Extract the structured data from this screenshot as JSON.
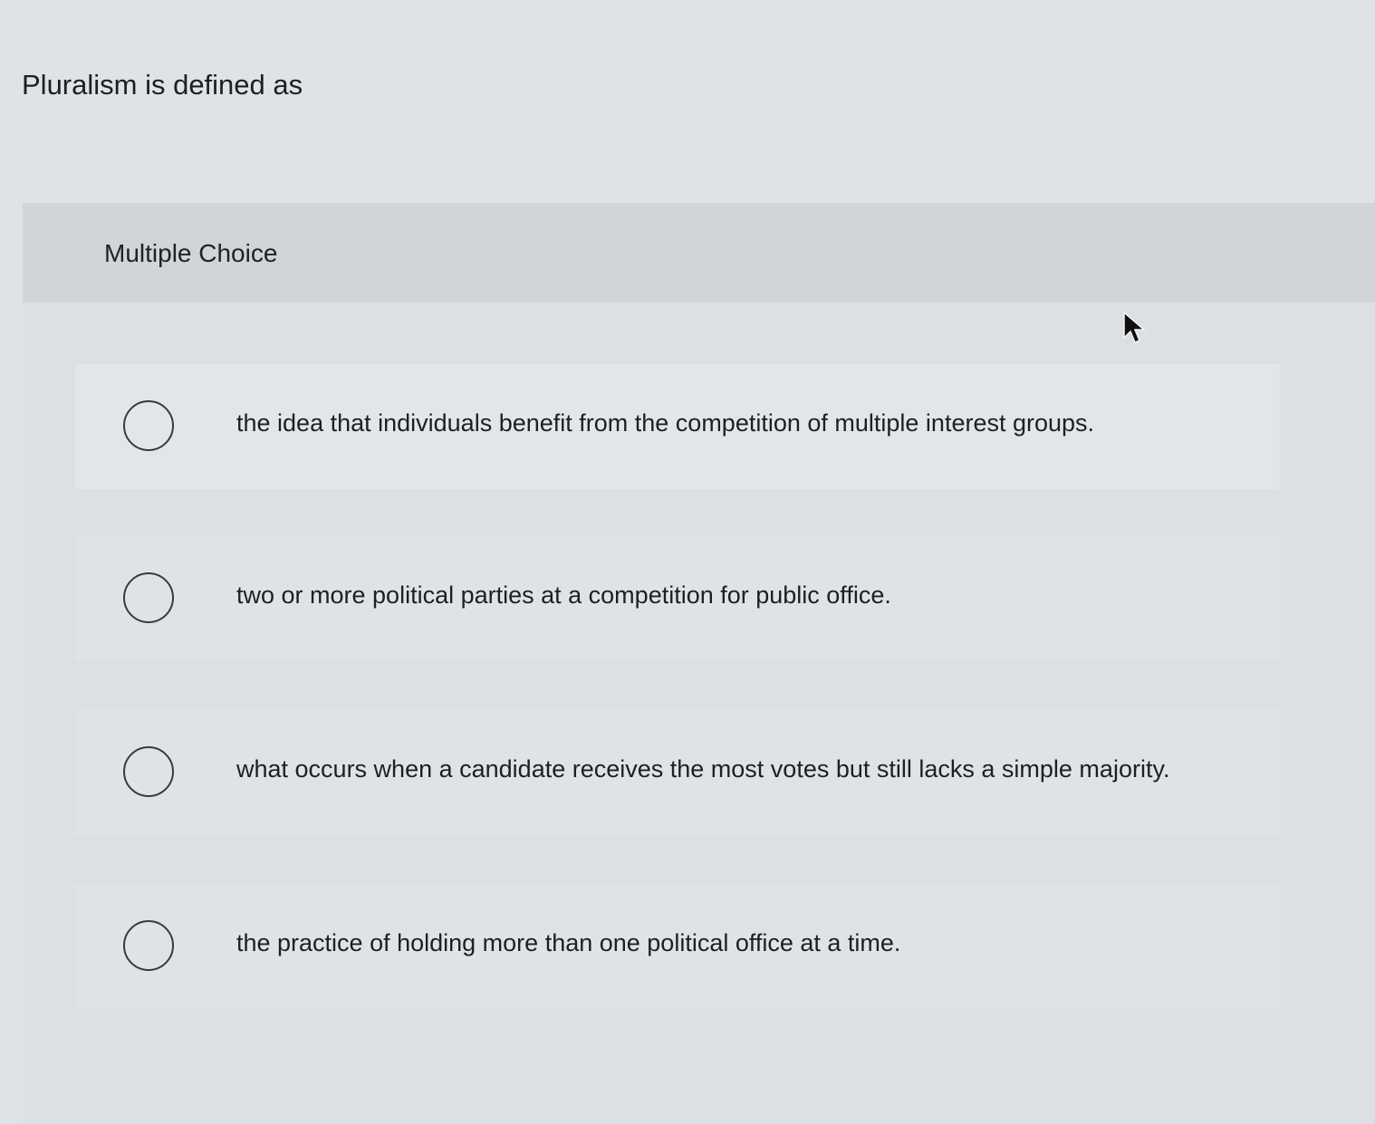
{
  "question": {
    "prompt": "Pluralism is defined as"
  },
  "panel": {
    "title": "Multiple Choice"
  },
  "options": [
    {
      "label": "the idea that individuals benefit from the competition of multiple interest groups."
    },
    {
      "label": "two or more political parties at a competition for public office."
    },
    {
      "label": "what occurs when a candidate receives the most votes but still lacks a simple majority."
    },
    {
      "label": "the practice of holding more than one political office at a time."
    }
  ],
  "icons": {
    "radio": "radio-unselected-icon",
    "cursor": "mouse-pointer-icon"
  }
}
